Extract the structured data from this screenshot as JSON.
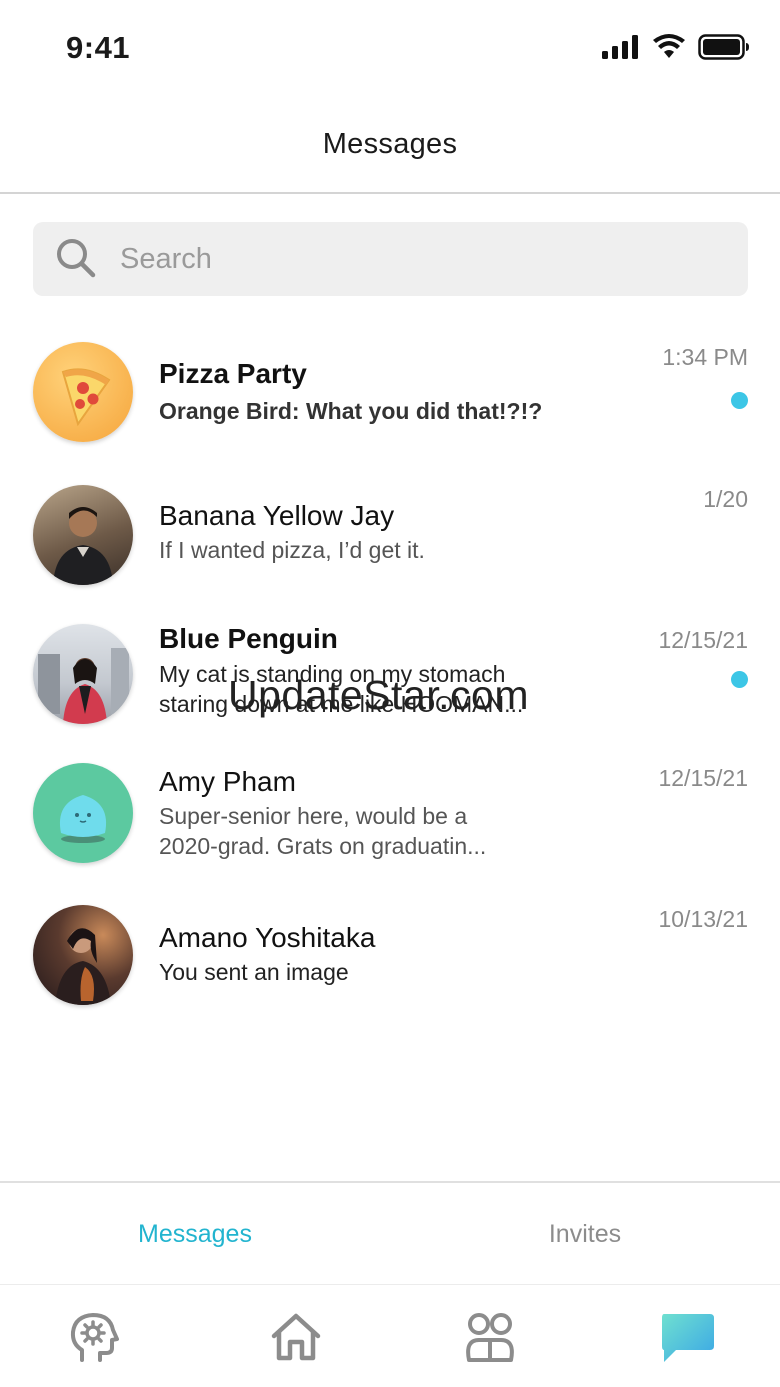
{
  "status_bar": {
    "time": "9:41",
    "icons": [
      "cellular-signal-icon",
      "wifi-icon",
      "battery-icon"
    ]
  },
  "header": {
    "title": "Messages"
  },
  "search": {
    "placeholder": "Search",
    "value": "",
    "icon": "search-icon"
  },
  "conversations": [
    {
      "name": "Pizza Party",
      "preview": "Orange Bird: What you did that!?!?",
      "time": "1:34 PM",
      "unread": true,
      "avatar": "pizza-avatar"
    },
    {
      "name": "Banana Yellow Jay",
      "preview": "If I wanted pizza, I’d get it.",
      "time": "1/20",
      "unread": false,
      "avatar": "photo-avatar"
    },
    {
      "name": "Blue Penguin",
      "preview": "My cat is standing on my stomach staring down at me like HOOMAN...",
      "time": "12/15/21",
      "unread": true,
      "avatar": "photo-avatar"
    },
    {
      "name": "Amy Pham",
      "preview": "Super-senior here, would be a 2020-grad. Grats on graduatin...",
      "time": "12/15/21",
      "unread": false,
      "avatar": "blob-avatar"
    },
    {
      "name": "Amano Yoshitaka",
      "preview": "You sent an image",
      "time": "10/13/21",
      "unread": false,
      "avatar": "photo-avatar"
    }
  ],
  "watermark": "UpdateStar.com",
  "segments": {
    "messages_label": "Messages",
    "invites_label": "Invites",
    "active": "Messages"
  },
  "tab_bar": {
    "items": [
      "head-gear-icon",
      "home-icon",
      "community-icon",
      "chat-bubble-icon"
    ],
    "active": "chat-bubble-icon"
  },
  "colors": {
    "accent": "#22b4cf",
    "unread_dot": "#3cc6e6",
    "inactive": "#8c8c8c",
    "pizza_avatar_bg": "#f8b34a",
    "blob_avatar_bg": "#5cc9a0"
  }
}
